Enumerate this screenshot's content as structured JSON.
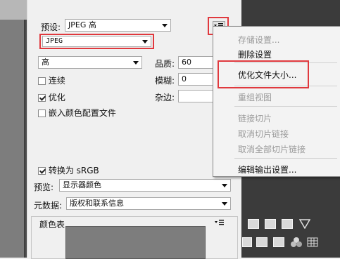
{
  "preset": {
    "label": "预设:",
    "value": "JPEG 高"
  },
  "format": {
    "value": "JPEG"
  },
  "quality_preset": {
    "value": "高"
  },
  "quality": {
    "label": "品质:",
    "value": "60"
  },
  "blur": {
    "label": "模糊:",
    "value": "0"
  },
  "matte": {
    "label": "杂边:",
    "value": ""
  },
  "options": {
    "progressive": {
      "label": "连续",
      "checked": false
    },
    "optimized": {
      "label": "优化",
      "checked": true
    },
    "embed_profile": {
      "label": "嵌入颜色配置文件",
      "checked": false
    },
    "convert_srgb": {
      "label": "转换为 sRGB",
      "checked": true
    }
  },
  "preview": {
    "label": "预览:",
    "value": "显示器颜色"
  },
  "metadata": {
    "label": "元数据:",
    "value": "版权和联系信息"
  },
  "color_table": {
    "label": "颜色表"
  },
  "menu": {
    "items": [
      {
        "label": "存储设置...",
        "enabled": false
      },
      {
        "label": "删除设置",
        "enabled": true
      },
      {
        "label": "优化文件大小...",
        "enabled": true
      },
      {
        "label": "重组视图",
        "enabled": false
      },
      {
        "label": "链接切片",
        "enabled": false
      },
      {
        "label": "取消切片链接",
        "enabled": false
      },
      {
        "label": "取消全部切片链接",
        "enabled": false
      },
      {
        "label": "编辑输出设置...",
        "enabled": true
      }
    ]
  },
  "colors": {
    "highlight": "#e0393e",
    "panel_bg": "#f0f0f0",
    "dark_panel": "#3b3b3b"
  }
}
